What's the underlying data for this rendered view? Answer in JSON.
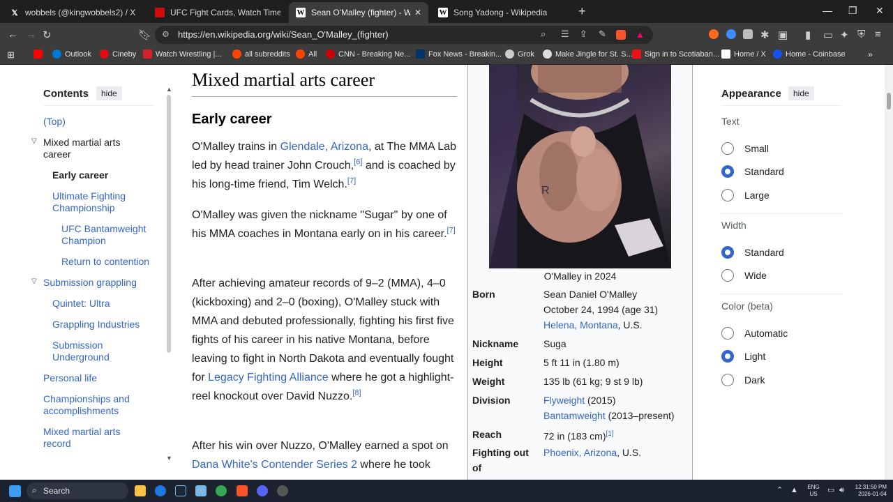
{
  "tabs": [
    {
      "title": "wobbels (@kingwobbels2) / X",
      "icon": "x-logo-icon"
    },
    {
      "title": "UFC Fight Cards, Watch Times, Live St",
      "icon": "ufc-icon"
    },
    {
      "title": "Sean O'Malley (fighter) - Wikipedia",
      "icon": "wikipedia-icon",
      "active": true
    },
    {
      "title": "Song Yadong - Wikipedia",
      "icon": "wikipedia-icon"
    }
  ],
  "address_bar": {
    "url": "https://en.wikipedia.org/wiki/Sean_O'Malley_(fighter)"
  },
  "bookmarks": [
    {
      "label": "",
      "icon": "youtube-icon",
      "color": "#ff0000"
    },
    {
      "label": "Outlook",
      "icon": "outlook-icon",
      "color": "#0078d4"
    },
    {
      "label": "Cineby",
      "icon": "cineby-icon",
      "color": "#e50914"
    },
    {
      "label": "Watch Wrestling |...",
      "icon": "wrestling-icon",
      "color": "#d61f2c"
    },
    {
      "label": "all subreddits",
      "icon": "reddit-icon",
      "color": "#ff4500"
    },
    {
      "label": "All",
      "icon": "reddit-icon",
      "color": "#ff4500"
    },
    {
      "label": "CNN - Breaking Ne...",
      "icon": "cnn-icon",
      "color": "#cc0000"
    },
    {
      "label": "Fox News - Breakin...",
      "icon": "fox-icon",
      "color": "#003366"
    },
    {
      "label": "Grok",
      "icon": "grok-icon",
      "color": "#cccccc"
    },
    {
      "label": "Make Jingle for St. S...",
      "icon": "chatgpt-icon",
      "color": "#dddddd"
    },
    {
      "label": "Sign in to Scotiaban...",
      "icon": "scotiabank-icon",
      "color": "#ec111a"
    },
    {
      "label": "Home / X",
      "icon": "x-logo-icon",
      "color": "#ffffff"
    },
    {
      "label": "Home - Coinbase",
      "icon": "coinbase-icon",
      "color": "#1652f0"
    }
  ],
  "toc": {
    "title": "Contents",
    "hide_label": "hide",
    "items": [
      {
        "label": "(Top)",
        "level": 0
      },
      {
        "label": "Mixed martial arts career",
        "level": 0,
        "expandable": true
      },
      {
        "label": "Early career",
        "level": 1,
        "current": true
      },
      {
        "label": "Ultimate Fighting Championship",
        "level": 1
      },
      {
        "label": "UFC Bantamweight Champion",
        "level": 2
      },
      {
        "label": "Return to contention",
        "level": 2
      },
      {
        "label": "Submission grappling",
        "level": 0,
        "expandable": true
      },
      {
        "label": "Quintet: Ultra",
        "level": 1
      },
      {
        "label": "Grappling Industries",
        "level": 1
      },
      {
        "label": "Submission Underground",
        "level": 1
      },
      {
        "label": "Personal life",
        "level": 0
      },
      {
        "label": "Championships and accomplishments",
        "level": 0
      },
      {
        "label": "Mixed martial arts record",
        "level": 0
      }
    ]
  },
  "article": {
    "h2": "Mixed martial arts career",
    "h3": "Early career",
    "p1": {
      "t1": "O'Malley trains in ",
      "link1": "Glendale, Arizona",
      "t2": ", at The MMA Lab led by head trainer John Crouch,",
      "ref1": "[6]",
      "t3": " and is coached by his long-time friend, Tim Welch.",
      "ref2": "[7]"
    },
    "p2": {
      "t1": "O'Malley was given the nickname \"Sugar\" by one of his MMA coaches in Montana early on in his career.",
      "ref1": "[7]"
    },
    "p3": {
      "t1": "After achieving amateur records of 9–2 (MMA), 4–0 (kickboxing) and 2–0 (boxing), O'Malley stuck with MMA and debuted professionally, fighting his first five fights of his career in his native Montana, before leaving to fight in North Dakota and eventually fought for ",
      "link1": "Legacy Fighting Alliance",
      "t2": " where he got a highlight-reel knockout over David Nuzzo.",
      "ref1": "[8]"
    },
    "p4": {
      "t1": "After his win over Nuzzo, O'Malley earned a spot on ",
      "link1": "Dana White's Contender Series 2",
      "t2": " where he took"
    }
  },
  "infobox": {
    "caption": "O'Malley in 2024",
    "born_label": "Born",
    "born_name": "Sean Daniel O'Malley",
    "born_date": "October 24, 1994 (age 31)",
    "born_place_link": "Helena, Montana",
    "born_place_rest": ", U.S.",
    "nickname_label": "Nickname",
    "nickname": "Suga",
    "height_label": "Height",
    "height": "5 ft 11 in (1.80 m)",
    "weight_label": "Weight",
    "weight": "135 lb (61 kg; 9 st 9 lb)",
    "division_label": "Division",
    "division_1_link": "Flyweight",
    "division_1_rest": " (2015)",
    "division_2_link": "Bantamweight",
    "division_2_rest": " (2013–present)",
    "reach_label": "Reach",
    "reach": "72 in (183 cm)",
    "reach_ref": "[1]",
    "fighting_label": "Fighting out of",
    "fighting_link": "Phoenix, Arizona",
    "fighting_rest": ", U.S."
  },
  "appearance": {
    "title": "Appearance",
    "hide_label": "hide",
    "text_label": "Text",
    "text_options": [
      "Small",
      "Standard",
      "Large"
    ],
    "text_selected": "Standard",
    "width_label": "Width",
    "width_options": [
      "Standard",
      "Wide"
    ],
    "width_selected": "Standard",
    "color_label": "Color (beta)",
    "color_options": [
      "Automatic",
      "Light",
      "Dark"
    ],
    "color_selected": "Light"
  },
  "taskbar": {
    "search_label": "Search",
    "lang_line1": "ENG",
    "lang_line2": "US",
    "time": "12:31:50 PM",
    "date": "2026-01-04"
  }
}
